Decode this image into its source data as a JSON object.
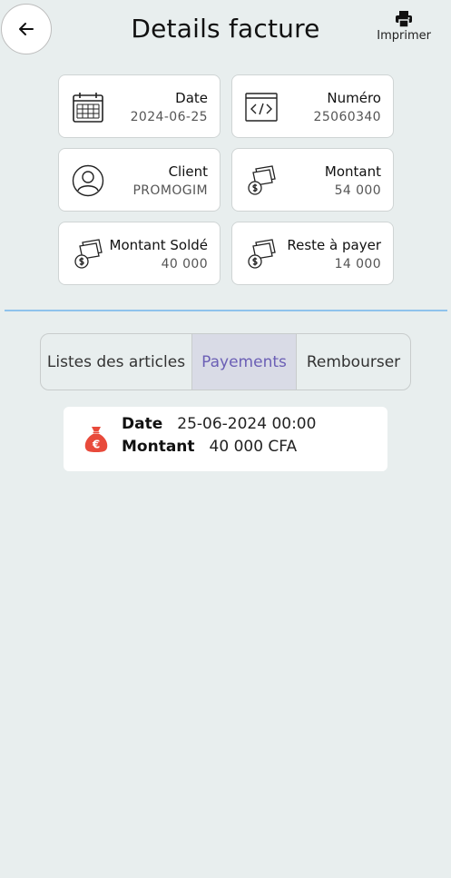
{
  "header": {
    "title": "Details facture",
    "print_label": "Imprimer"
  },
  "cards": [
    {
      "label": "Date",
      "value": "2024-06-25",
      "icon": "calendar-icon"
    },
    {
      "label": "Numéro",
      "value": "25060340",
      "icon": "code-icon"
    },
    {
      "label": "Client",
      "value": "PROMOGIM",
      "icon": "user-icon"
    },
    {
      "label": "Montant",
      "value": "54 000",
      "icon": "money-icon"
    },
    {
      "label": "Montant Soldé",
      "value": "40 000",
      "icon": "money-icon"
    },
    {
      "label": "Reste à payer",
      "value": "14 000",
      "icon": "money-icon"
    }
  ],
  "tabs": [
    {
      "label": "Listes des articles",
      "active": false
    },
    {
      "label": "Payements",
      "active": true
    },
    {
      "label": "Rembourser",
      "active": false
    }
  ],
  "payments": [
    {
      "date_label": "Date",
      "date_value": "25-06-2024 00:00",
      "amount_label": "Montant",
      "amount_value": "40 000 CFA",
      "icon": "money-bag-euro-icon"
    }
  ],
  "colors": {
    "background": "#e8eeee",
    "active_tab_bg": "#d9dbe6",
    "active_tab_text": "#6b5fb5",
    "divider": "#8fc3ec",
    "money_bag": "#e84a3b"
  }
}
